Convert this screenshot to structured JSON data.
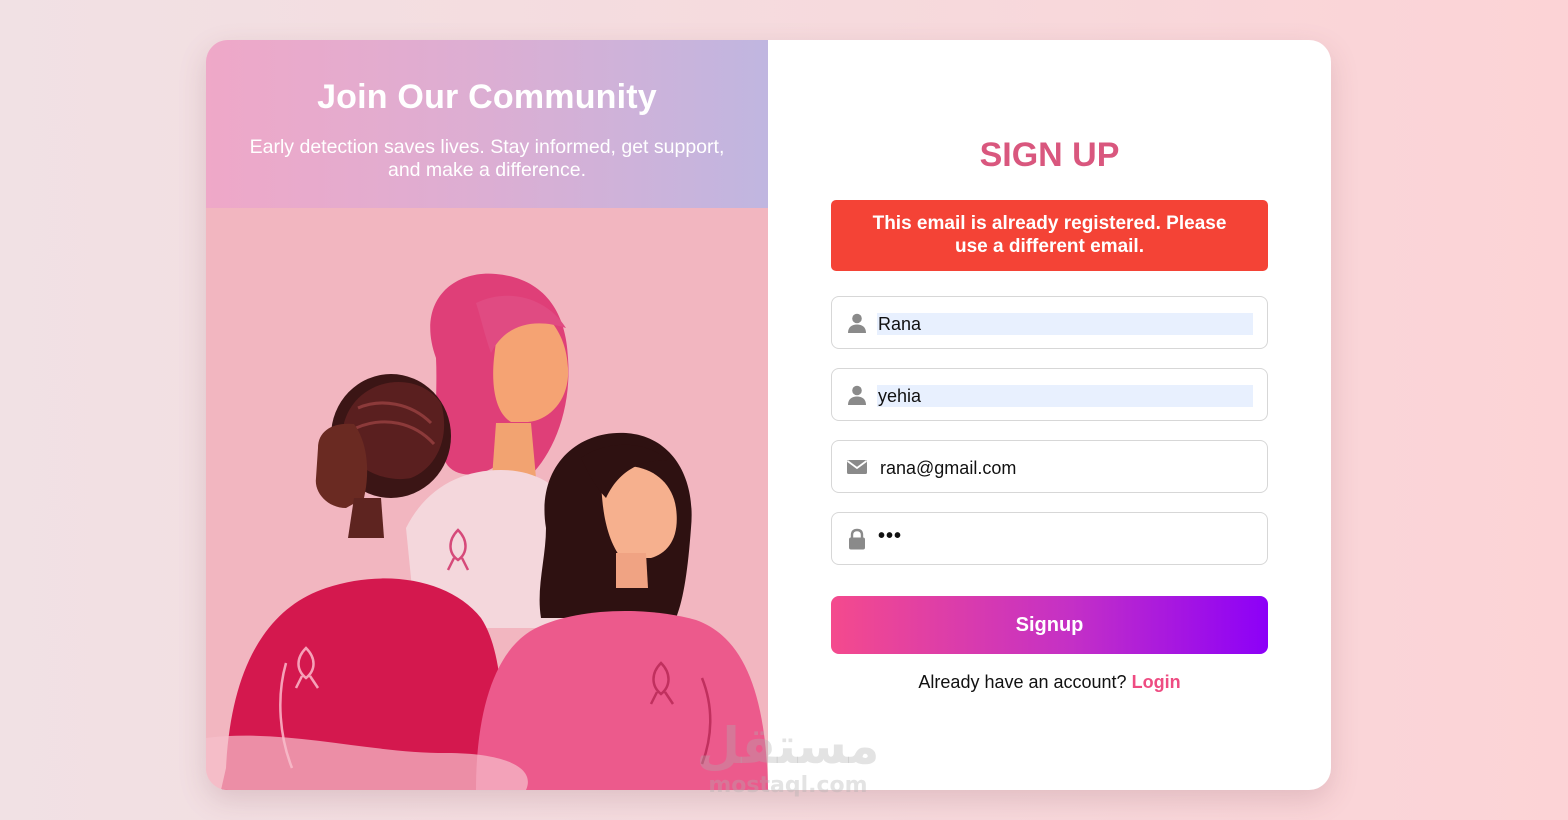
{
  "community": {
    "title": "Join Our Community",
    "subtitle": "Early detection saves lives. Stay informed, get support, and make a difference."
  },
  "form": {
    "title": "SIGN UP",
    "error": "This email is already registered. Please use a different email.",
    "first_name": "Rana",
    "last_name": "yehia",
    "email": "rana@gmail.com",
    "password_mask": "•••",
    "submit_label": "Signup",
    "account_prompt": "Already have an account?",
    "login_label": "Login"
  },
  "icons": {
    "first_name": "user-icon",
    "last_name": "user-icon",
    "email": "envelope-icon",
    "password": "lock-icon"
  },
  "watermark": {
    "arabic": "مستقل",
    "latin": "mostaql.com"
  },
  "colors": {
    "title_pink": "#d9577e",
    "error_red": "#f44336",
    "login_pink": "#ee4c82",
    "button_start": "#f44a8d",
    "button_end": "#8c00f8"
  }
}
